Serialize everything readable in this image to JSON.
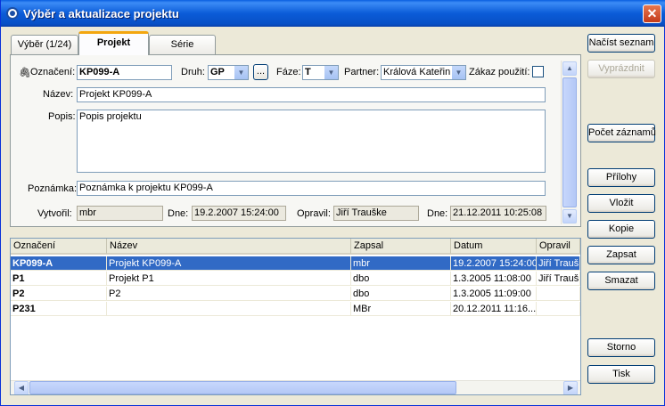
{
  "window": {
    "title": "Výběr a aktualizace projektu"
  },
  "tabs": [
    {
      "label": "Výběr (1/24)"
    },
    {
      "label": "Projekt"
    },
    {
      "label": "Série"
    }
  ],
  "form": {
    "oznaceni_label": "Označení:",
    "oznaceni_value": "KP099-A",
    "druh_label": "Druh:",
    "druh_value": "GP",
    "browse_label": "...",
    "faze_label": "Fáze:",
    "faze_value": "T",
    "partner_label": "Partner:",
    "partner_value": "Králová Kateřin",
    "zakaz_label": "Zákaz použití:",
    "nazev_label": "Název:",
    "nazev_value": "Projekt KP099-A",
    "popis_label": "Popis:",
    "popis_value": "Popis projektu",
    "poznamka_label": "Poznámka:",
    "poznamka_value": "Poznámka k projektu KP099-A",
    "vytvoril_label": "Vytvořil:",
    "vytvoril_value": "mbr",
    "dne1_label": "Dne:",
    "dne1_value": "19.2.2007 15:24:00",
    "opravil_label": "Opravil:",
    "opravil_value": "Jiří Trauške",
    "dne2_label": "Dne:",
    "dne2_value": "21.12.2011 10:25:08"
  },
  "table": {
    "columns": [
      "Označení",
      "Název",
      "Zapsal",
      "Datum",
      "Opravil"
    ],
    "rows": [
      [
        "KP099-A",
        "Projekt KP099-A",
        "mbr",
        "19.2.2007 15:24:00",
        "Jiří Trauške"
      ],
      [
        "P1",
        "Projekt P1",
        "dbo",
        "1.3.2005 11:08:00",
        "Jiří Trauške"
      ],
      [
        "P2",
        "P2",
        "dbo",
        "1.3.2005 11:09:00",
        ""
      ],
      [
        "P231",
        "",
        "MBr",
        "20.12.2011 11:16...",
        ""
      ]
    ]
  },
  "buttons": {
    "nacist": "Načíst seznam",
    "vyprazdnit": "Vyprázdnit",
    "pocet": "Počet záznamů",
    "prilohy": "Přílohy",
    "vlozit": "Vložit",
    "kopie": "Kopie",
    "zapsat": "Zapsat",
    "smazat": "Smazat",
    "storno": "Storno",
    "tisk": "Tisk"
  }
}
